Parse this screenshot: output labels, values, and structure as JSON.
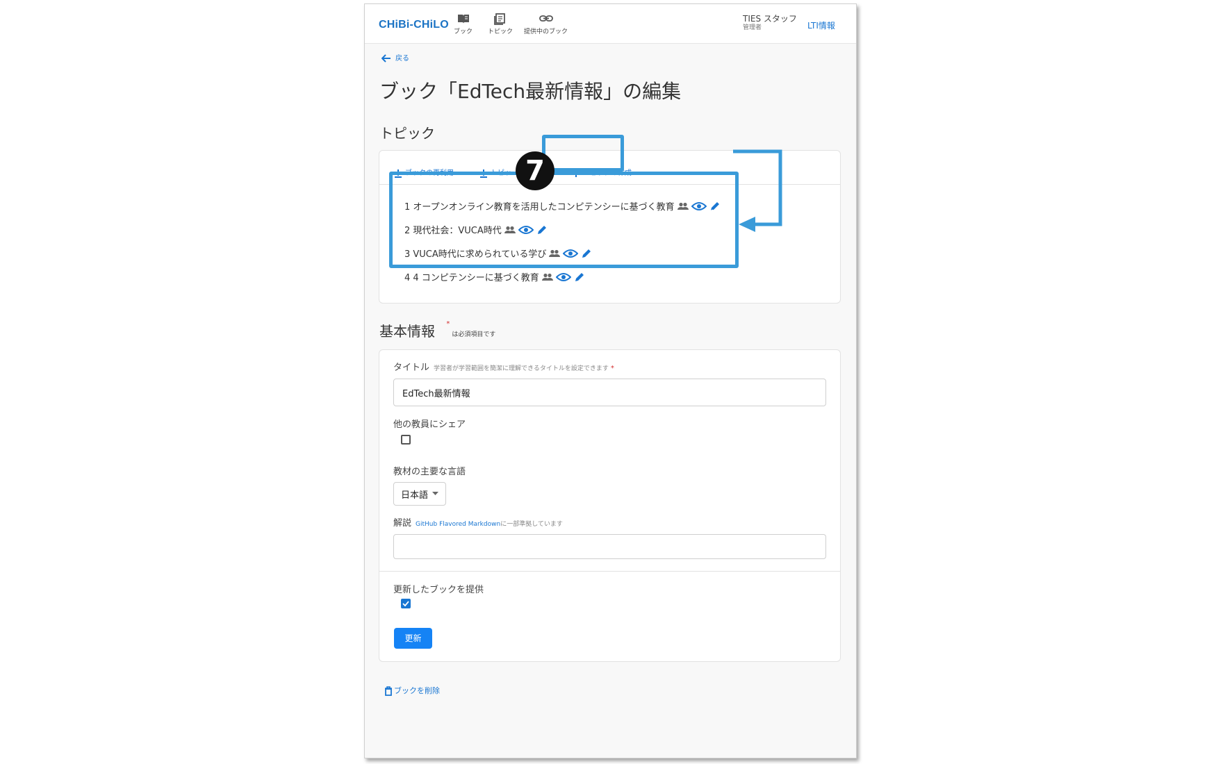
{
  "header": {
    "brand": "CHiBi-CHiLO",
    "nav": [
      {
        "label": "ブック",
        "icon": "book-icon"
      },
      {
        "label": "トピック",
        "icon": "topics-icon"
      },
      {
        "label": "提供中のブック",
        "icon": "link-icon"
      }
    ],
    "user_name": "TIES スタッフ",
    "user_role": "管理者",
    "lti_link": "LTI情報"
  },
  "back_label": "戻る",
  "page_title": "ブック「EdTech最新情報」の編集",
  "topics_section": {
    "heading": "トピック",
    "toolbar": {
      "reuse_book": "ブックの再利用",
      "import_topic": "トピッ",
      "import_topic_tail": "用",
      "create_topic": "トピックの作成"
    },
    "items": [
      {
        "label": "1 オープンオンライン教育を活用したコンピテンシーに基づく教育"
      },
      {
        "label": "2 現代社会：VUCA時代"
      },
      {
        "label": "3 VUCA時代に求められている学び"
      },
      {
        "label": "4 4 コンピテンシーに基づく教育"
      }
    ]
  },
  "annotation": {
    "step_number": "7",
    "highlight_color": "#3a9bd9"
  },
  "basic_info": {
    "heading": "基本情報",
    "required_mark": "*",
    "required_note": "は必須項目です",
    "title_label": "タイトル",
    "title_hint": "学習者が学習範囲を簡潔に理解できるタイトルを設定できます",
    "title_value": "EdTech最新情報",
    "share_label": "他の教員にシェア",
    "share_checked": false,
    "language_label": "教材の主要な言語",
    "language_value": "日本語",
    "description_label": "解説",
    "description_hint_link": "GitHub Flavored Markdown",
    "description_hint_rest": "に一部準拠しています",
    "description_value": "",
    "provide_label": "更新したブックを提供",
    "provide_checked": true,
    "update_button": "更新"
  },
  "delete_book": "ブックを削除",
  "colors": {
    "accent": "#1976d2",
    "button": "#1583f5"
  }
}
